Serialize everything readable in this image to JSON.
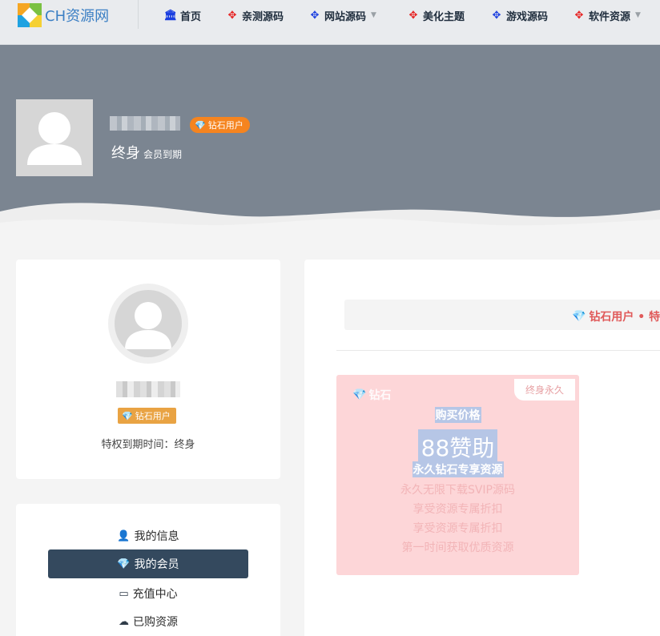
{
  "brand": {
    "name": "CH资源网"
  },
  "nav": {
    "items": [
      {
        "label": "首页",
        "icon": "bank-icon",
        "color": "#1a3ee0"
      },
      {
        "label": "亲测源码",
        "icon": "pinwheel-icon",
        "color": "#e62020"
      },
      {
        "label": "网站源码",
        "icon": "pinwheel-icon",
        "color": "#1a3ee0",
        "has_dropdown": true
      },
      {
        "label": "美化主题",
        "icon": "pinwheel-icon",
        "color": "#e62020"
      },
      {
        "label": "游戏源码",
        "icon": "pinwheel-icon",
        "color": "#1a3ee0"
      },
      {
        "label": "软件资源",
        "icon": "pinwheel-icon",
        "color": "#e62020",
        "has_dropdown": true
      }
    ]
  },
  "hero": {
    "badge": "钻石用户",
    "term": "终身",
    "term_suffix": "会员到期"
  },
  "profile": {
    "badge": "钻石用户",
    "expire_text": "特权到期时间：终身"
  },
  "menu": {
    "items": [
      {
        "label": "我的信息",
        "icon": "user-icon",
        "active": false
      },
      {
        "label": "我的会员",
        "icon": "diamond-icon",
        "active": true
      },
      {
        "label": "充值中心",
        "icon": "credit-card-icon",
        "active": false
      },
      {
        "label": "已购资源",
        "icon": "cloud-download-icon",
        "active": false
      }
    ]
  },
  "main": {
    "notice": "钻石用户 • 特",
    "plan": {
      "brand": "钻石",
      "tag": "终身永久",
      "price_label": "购买价格",
      "price": "88赞助",
      "title": "永久钻石专享资源",
      "features": [
        "永久无限下载SVIP源码",
        "享受资源专属折扣",
        "享受资源专属折扣",
        "第一时间获取优质资源"
      ]
    }
  },
  "colors": {
    "accent_orange": "#f5841f",
    "menu_active": "#34495e",
    "plan_bg": "#fdd6d8"
  }
}
